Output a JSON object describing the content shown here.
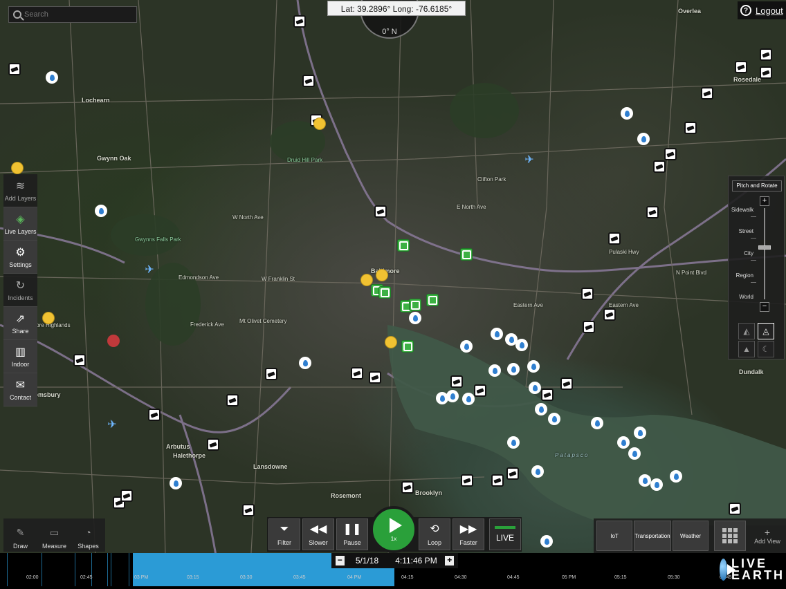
{
  "search": {
    "placeholder": "Search"
  },
  "coords": {
    "text": "Lat: 39.2896° Long: -76.6185°"
  },
  "compass": {
    "heading": "0° N"
  },
  "header": {
    "logout_label": "Logout"
  },
  "left_toolbar": [
    {
      "id": "add-layers",
      "label": "Add Layers",
      "icon": "layers-stack-icon"
    },
    {
      "id": "live-layers",
      "label": "Live Layers",
      "icon": "live-layers-icon"
    },
    {
      "id": "settings",
      "label": "Settings",
      "icon": "gear-icon"
    },
    {
      "id": "incidents",
      "label": "Incidents",
      "icon": "incident-icon"
    },
    {
      "id": "share",
      "label": "Share",
      "icon": "share-icon"
    },
    {
      "id": "indoor",
      "label": "Indoor",
      "icon": "building-icon"
    },
    {
      "id": "contact",
      "label": "Contact",
      "icon": "envelope-icon"
    }
  ],
  "zoom_panel": {
    "pitch_label": "Pitch and Rotate",
    "plus": "+",
    "minus": "−",
    "levels": [
      "Sidewalk",
      "Street",
      "City",
      "Region",
      "World"
    ],
    "current_level": "City"
  },
  "draw_toolbar": [
    {
      "id": "draw",
      "label": "Draw",
      "icon": "pencil-icon"
    },
    {
      "id": "measure",
      "label": "Measure",
      "icon": "ruler-icon"
    },
    {
      "id": "shapes",
      "label": "Shapes",
      "icon": "shapes-icon"
    }
  ],
  "playback": {
    "filter": "Filter",
    "slower": "Slower",
    "pause": "Pause",
    "play_speed": "1x",
    "loop": "Loop",
    "faster": "Faster",
    "live": "LIVE"
  },
  "view_toolbar": {
    "iot": "IoT",
    "transportation": "Transportation",
    "weather": "Weather",
    "add_view": "Add View",
    "add_plus": "+"
  },
  "timeline": {
    "date": "5/1/18",
    "time": "4:11:46 PM",
    "minus": "−",
    "plus": "+",
    "ticks": [
      "02:00",
      "02:45",
      "03 PM",
      "03:15",
      "03:30",
      "03:45",
      "04 PM",
      "04:15",
      "04:30",
      "04:45",
      "05 PM",
      "05:15",
      "05:30",
      "05:45"
    ],
    "progress_fraction": 0.5
  },
  "logo": {
    "line1": "LIVE",
    "line2": "EARTH"
  },
  "map_labels": [
    "Lochearn",
    "Gwynn Oak",
    "Baltimore",
    "Druid Hill Park",
    "Edmondson Ave",
    "W Franklin St",
    "Eastern Ave",
    "N Point Blvd",
    "Dundalk",
    "Rosedale",
    "Overlea",
    "Arbutus",
    "Halethorpe",
    "Lansdowne",
    "Rosemont",
    "Bloomsbury",
    "Brooklyn",
    "Patapsco",
    "Baltimore Highlands",
    "Mt Olivet Cemetery",
    "E North Ave",
    "W North Ave",
    "Clifton Park",
    "Eastern Ave",
    "Frederick Ave",
    "Gwynns Falls Park",
    "Pulaski Hwy"
  ],
  "colors": {
    "accent_green": "#2aa03a",
    "timeline_blue": "#2b9bd6",
    "camera_marker": "#ffffff",
    "weather_marker": "#2f7fd0",
    "transit_marker": "#3cb043",
    "traffic_marker": "#f1c232"
  }
}
